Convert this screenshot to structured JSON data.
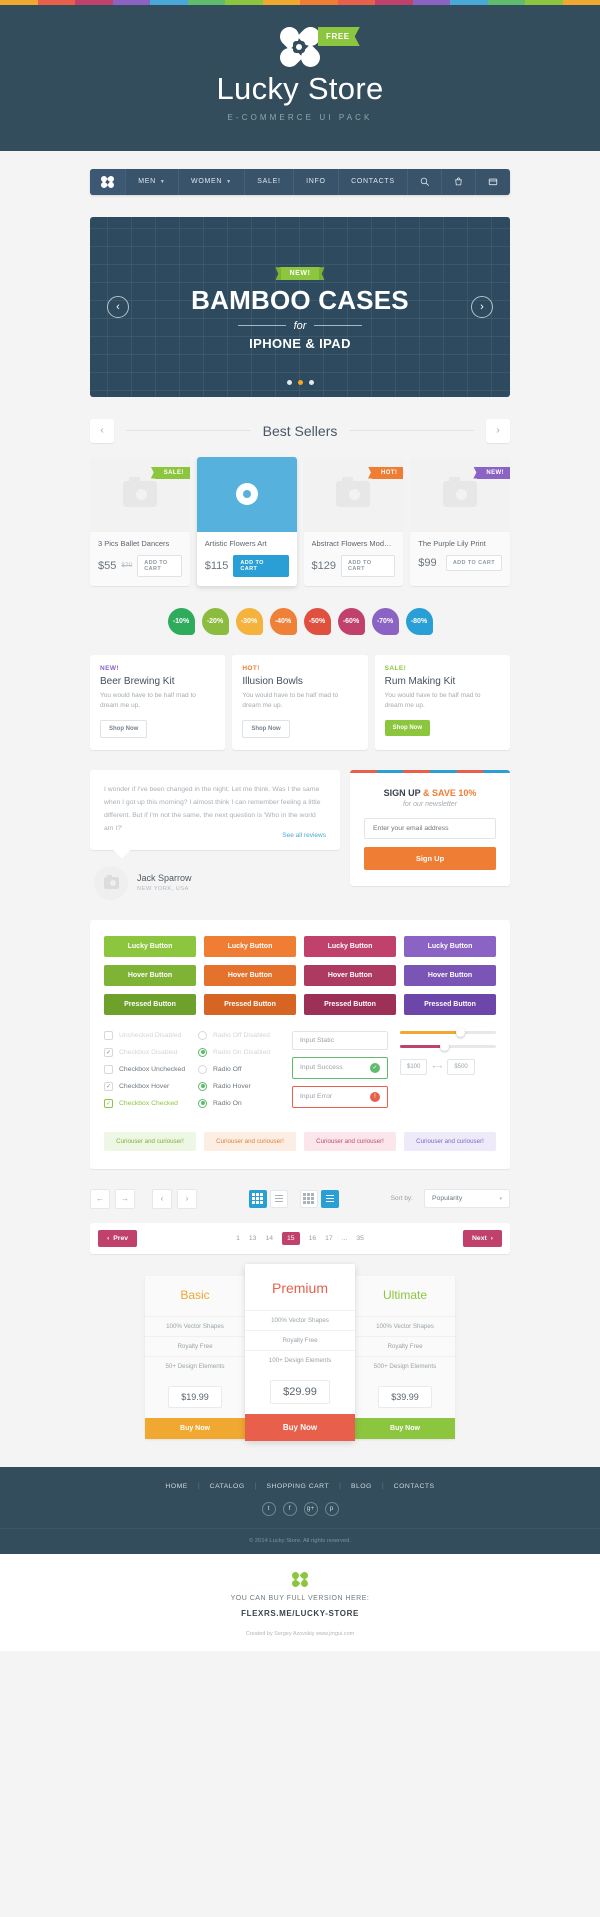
{
  "rainbow_colors": [
    "#f0a830",
    "#e8604c",
    "#c0426c",
    "#8a63c4",
    "#4aa8d8",
    "#5fbb6e",
    "#8cc63e",
    "#f0a830",
    "#ef7d34",
    "#e8604c",
    "#c0426c",
    "#8a63c4",
    "#4aa8d8",
    "#5fbb6e",
    "#8cc63e",
    "#f0a830"
  ],
  "header": {
    "brand": "Lucky Store",
    "subtitle": "E-COMMERCE UI PACK",
    "free_badge": "FREE",
    "bg": "#334d5c"
  },
  "nav": {
    "items": [
      {
        "label": "MEN",
        "caret": true
      },
      {
        "label": "WOMEN",
        "caret": true
      },
      {
        "label": "SALE!",
        "caret": false
      },
      {
        "label": "INFO",
        "caret": false
      },
      {
        "label": "CONTACTS",
        "caret": false
      }
    ],
    "icons": [
      "search-icon",
      "bag-icon",
      "card-icon"
    ]
  },
  "hero": {
    "ribbon": "NEW!",
    "title": "BAMBOO CASES",
    "connector": "for",
    "subtitle": "IPHONE & IPAD",
    "prev": "‹",
    "next": "›",
    "dots": [
      false,
      true,
      false
    ]
  },
  "best_sellers": {
    "title": "Best Sellers",
    "prev": "‹",
    "next": "›",
    "products": [
      {
        "name": "3 Pics Ballet Dancers",
        "price": "$55",
        "old_price": "$70",
        "badge": "SALE!",
        "badge_class": "t-sale",
        "cta": "ADD TO CART",
        "active": false
      },
      {
        "name": "Artistic Flowers Art",
        "price": "$115",
        "old_price": "",
        "badge": "",
        "badge_class": "",
        "cta": "ADD TO CART",
        "active": true
      },
      {
        "name": "Abstract Flowers Moder...",
        "price": "$129",
        "old_price": "",
        "badge": "HOT!",
        "badge_class": "t-hot",
        "cta": "ADD TO CART",
        "active": false
      },
      {
        "name": "The Purple Lily Print",
        "price": "$99",
        "old_price": "",
        "badge": "NEW!",
        "badge_class": "t-new",
        "cta": "ADD TO CART",
        "active": false
      }
    ]
  },
  "discounts": [
    {
      "label": "-10%",
      "color": "#2eab5b"
    },
    {
      "label": "-20%",
      "color": "#8cbc3f"
    },
    {
      "label": "-30%",
      "color": "#f3b33d"
    },
    {
      "label": "-40%",
      "color": "#ef8037"
    },
    {
      "label": "-50%",
      "color": "#e0503f"
    },
    {
      "label": "-60%",
      "color": "#c0426c"
    },
    {
      "label": "-70%",
      "color": "#8a63c4"
    },
    {
      "label": "-80%",
      "color": "#2a9fd6"
    }
  ],
  "promos": [
    {
      "tag": "NEW!",
      "tag_color": "#8a63c4",
      "title": "Beer Brewing Kit",
      "desc": "You would have to be half mad to dream me up.",
      "button": "Shop Now",
      "style": "ghost"
    },
    {
      "tag": "HOT!",
      "tag_color": "#ef7d34",
      "title": "Illusion Bowls",
      "desc": "You would have to be half mad to dream me up.",
      "button": "Shop Now",
      "style": "ghost"
    },
    {
      "tag": "SALE!",
      "tag_color": "#8cc63e",
      "title": "Rum Making Kit",
      "desc": "You would have to be half mad to dream me up.",
      "button": "Shop Now",
      "style": "green"
    }
  ],
  "testimonial": {
    "quote": "I wonder if I've been changed in the night. Let me think. Was I the same when I got up this morning? I almost think I can remember feeling a little different. But if I'm not the same, the next question is 'Who in the world am I?'",
    "see_all": "See all reviews",
    "author": "Jack Sparrow",
    "location": "NEW YORK, USA"
  },
  "newsletter": {
    "stripe_colors": [
      "#e8604c",
      "#2a9fd6",
      "#e8604c",
      "#2a9fd6",
      "#e8604c",
      "#2a9fd6"
    ],
    "title_main": "SIGN UP ",
    "title_accent": "& SAVE 10%",
    "subtitle": "for our newsletter",
    "placeholder": "Enter your email address",
    "button": "Sign Up"
  },
  "ui_kit": {
    "button_rows": [
      {
        "label_key": "lucky",
        "labels": [
          "Lucky Button",
          "Lucky Button",
          "Lucky Button",
          "Lucky Button"
        ],
        "colors": [
          "#8cc63e",
          "#ef7d34",
          "#c0426c",
          "#8a63c4"
        ]
      },
      {
        "label_key": "hover",
        "labels": [
          "Hover Button",
          "Hover Button",
          "Hover Button",
          "Hover Button"
        ],
        "colors": [
          "#7fb336",
          "#e5722c",
          "#ad3a61",
          "#7a55b5"
        ]
      },
      {
        "label_key": "pressed",
        "labels": [
          "Pressed Button",
          "Pressed Button",
          "Pressed Button",
          "Pressed Button"
        ],
        "colors": [
          "#6ea02c",
          "#d66524",
          "#9c3056",
          "#6c46a8"
        ]
      }
    ],
    "checkboxes": [
      {
        "label": "Unchecked Disabled",
        "state": "dim",
        "checked": false
      },
      {
        "label": "Checkbox Disabled",
        "state": "dim",
        "checked": true
      },
      {
        "label": "Checkbox Unchecked",
        "state": "norm",
        "checked": false
      },
      {
        "label": "Checkbox Hover",
        "state": "norm",
        "checked": true
      },
      {
        "label": "Checkbox Checked",
        "state": "grn",
        "checked": true
      }
    ],
    "radios": [
      {
        "label": "Radio Off Disabled",
        "state": "dim",
        "on": false
      },
      {
        "label": "Radio On Disabled",
        "state": "dim",
        "on": true
      },
      {
        "label": "Radio Off",
        "state": "norm",
        "on": false
      },
      {
        "label": "Radio Hover",
        "state": "norm",
        "on": true
      },
      {
        "label": "Radio On",
        "state": "norm",
        "on": true
      }
    ],
    "inputs": [
      {
        "value": "Input Static",
        "state": "plain",
        "icon": ""
      },
      {
        "value": "Input Success",
        "state": "ok",
        "icon": "✓"
      },
      {
        "value": "Input Error",
        "state": "err",
        "icon": "!"
      }
    ],
    "sliders": [
      {
        "fill": "#f0a830",
        "pct": 62
      },
      {
        "fill": "#c0426c",
        "pct": 46
      }
    ],
    "range": {
      "min": "$100",
      "max": "$500",
      "dash": "⟷"
    },
    "tags": [
      "Curiouser and curiouser!",
      "Curiouser and curiouser!",
      "Curiouser and curiouser!",
      "Curiouser and curiouser!"
    ]
  },
  "toolbar": {
    "nav_buttons": [
      "←",
      "→",
      "‹",
      "›"
    ],
    "sort_label": "Sort by:",
    "sort_value": "Popularity",
    "caret": "▾"
  },
  "pagination": {
    "prev": "Prev",
    "next": "Next",
    "prev_arrow": "‹",
    "next_arrow": "›",
    "pages": [
      "1",
      "13",
      "14",
      "15",
      "16",
      "17",
      "...",
      "35"
    ],
    "current": "15"
  },
  "pricing": [
    {
      "name": "Basic",
      "color": "#f0a830",
      "features": [
        "100% Vector Shapes",
        "Royalty Free",
        "50+ Design Elements"
      ],
      "price": "$19.99",
      "button": "Buy Now",
      "button_color": "#f0a830",
      "highlight": false
    },
    {
      "name": "Premium",
      "color": "#e8604c",
      "features": [
        "100% Vector Shapes",
        "Royalty Free",
        "100+ Design Elements"
      ],
      "price": "$29.99",
      "button": "Buy Now",
      "button_color": "#e8604c",
      "highlight": true
    },
    {
      "name": "Ultimate",
      "color": "#8cc63e",
      "features": [
        "100% Vector Shapes",
        "Royalty Free",
        "500+ Design Elements"
      ],
      "price": "$39.99",
      "button": "Buy Now",
      "button_color": "#8cc63e",
      "highlight": false
    }
  ],
  "footer": {
    "links": [
      "HOME",
      "CATALOG",
      "SHOPPING CART",
      "BLOG",
      "CONTACTS"
    ],
    "socials": [
      "t",
      "f",
      "g+",
      "p"
    ],
    "copyright": "© 2014 Lucky Store. All rights reserved."
  },
  "cta": {
    "line1": "YOU CAN BUY FULL VERSION HERE:",
    "line2": "FLEXRS.ME/LUCKY-STORE",
    "line3": "Created by Sergey Azovskiy  www.jmgui.com"
  }
}
